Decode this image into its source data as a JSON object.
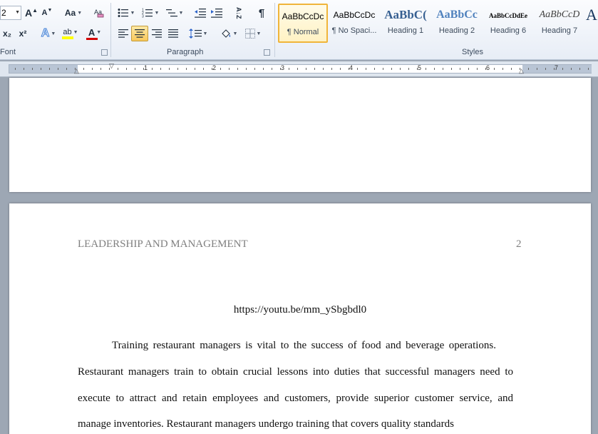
{
  "font": {
    "size_value": "2",
    "grow_label": "A",
    "shrink_label": "A",
    "change_case_label": "Aa",
    "subscript_label": "x₂",
    "superscript_label": "x²",
    "text_effects_label": "A",
    "highlight_label": "ab",
    "font_color_label": "A",
    "group_label": "Font"
  },
  "paragraph": {
    "group_label": "Paragraph",
    "sort_label": "A↓Z",
    "pilcrow_label": "¶"
  },
  "styles": {
    "group_label": "Styles",
    "items": [
      {
        "sample": "AaBbCcDc",
        "name": "¶ Normal"
      },
      {
        "sample": "AaBbCcDc",
        "name": "¶ No Spaci..."
      },
      {
        "sample": "AaBbC(",
        "name": "Heading 1"
      },
      {
        "sample": "AaBbCc",
        "name": "Heading 2"
      },
      {
        "sample": "AaBbCcDdEe",
        "name": "Heading 6"
      },
      {
        "sample": "AaBbCcD",
        "name": "Heading 7"
      },
      {
        "sample": "A",
        "name": ""
      }
    ]
  },
  "ruler": {
    "numbers": [
      "1",
      "2",
      "3",
      "4",
      "5",
      "6",
      "7"
    ]
  },
  "document": {
    "header": "LEADERSHIP AND MANAGEMENT",
    "page_number": "2",
    "url": "https://youtu.be/mm_ySbgbdl0",
    "lines": [
      "Training restaurant managers is vital to the success of food and beverage operations.",
      "Restaurant managers train to obtain crucial lessons into duties that successful managers need to",
      "execute to attract and retain employees and customers, provide superior customer service, and",
      "manage inventories. Restaurant managers undergo training that covers quality standards"
    ]
  },
  "colors": {
    "accent_selected": "#f0b53a",
    "highlight": "#ffff00",
    "font_color": "#d40000",
    "heading_blue": "#365f91",
    "heading2_blue": "#4f81bd"
  }
}
